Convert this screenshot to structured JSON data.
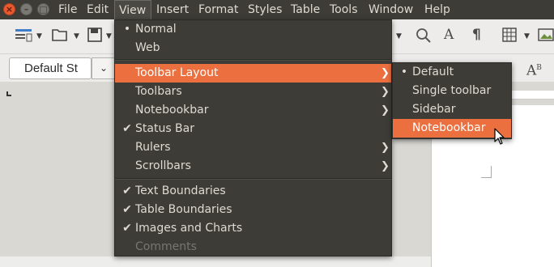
{
  "menubar": {
    "items": [
      "File",
      "Edit",
      "View",
      "Insert",
      "Format",
      "Styles",
      "Table",
      "Tools",
      "Window",
      "Help"
    ]
  },
  "window_buttons": {
    "close": "×",
    "minimize": "–",
    "maximize": "□"
  },
  "toolbar": {
    "paragraph_style": "Default St",
    "icons": [
      "sidebar-icon",
      "open-icon",
      "save-icon",
      "find-replace-icon",
      "spelling-icon",
      "formatting-marks-icon",
      "insert-table-icon",
      "insert-image-icon",
      "font-size-icon"
    ]
  },
  "view_menu": {
    "items": [
      {
        "label": "Normal",
        "mark": "•"
      },
      {
        "label": "Web",
        "mark": ""
      },
      {
        "label": "Toolbar Layout",
        "mark": "",
        "submenu": true,
        "highlighted": true
      },
      {
        "label": "Toolbars",
        "mark": "",
        "submenu": true
      },
      {
        "label": "Notebookbar",
        "mark": "",
        "submenu": true
      },
      {
        "label": "Status Bar",
        "mark": "✔"
      },
      {
        "label": "Rulers",
        "mark": "",
        "submenu": true
      },
      {
        "label": "Scrollbars",
        "mark": "",
        "submenu": true
      },
      {
        "label": "Text Boundaries",
        "mark": "✔"
      },
      {
        "label": "Table Boundaries",
        "mark": "✔"
      },
      {
        "label": "Images and Charts",
        "mark": "✔"
      },
      {
        "label": "Comments",
        "mark": "",
        "disabled": true
      }
    ]
  },
  "toolbar_layout_submenu": {
    "items": [
      {
        "label": "Default",
        "mark": "•"
      },
      {
        "label": "Single toolbar",
        "mark": ""
      },
      {
        "label": "Sidebar",
        "mark": ""
      },
      {
        "label": "Notebookbar",
        "mark": "",
        "highlighted": true
      }
    ]
  },
  "colors": {
    "menu_bg": "#3d3c37",
    "menu_text": "#dfdbd2",
    "highlight": "#ec6f3f",
    "close_button": "#e8592f"
  }
}
